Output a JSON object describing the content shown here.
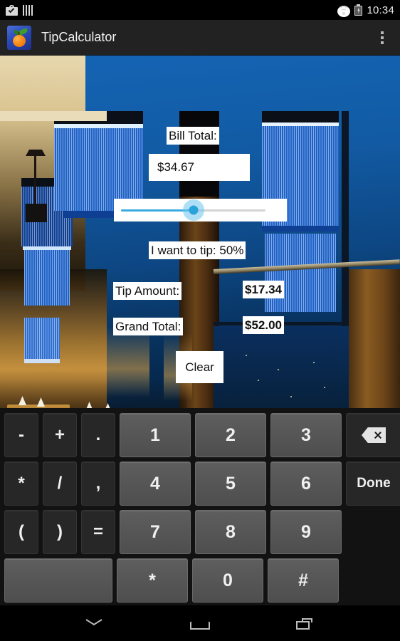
{
  "statusbar": {
    "time": "10:34",
    "icons": [
      "briefcase-check-icon",
      "barcode-icon",
      "wifi-icon",
      "battery-charging-icon"
    ]
  },
  "actionbar": {
    "app_title": "TipCalculator",
    "app_icon": "orange-fruit-icon",
    "overflow_label": "overflow-menu-icon"
  },
  "app": {
    "bill_label": "Bill Total:",
    "bill_value": "$34.67",
    "tip_percent_label": "I want to tip: 50%",
    "tip_percent": 50,
    "tip_amount_label": "Tip Amount:",
    "tip_amount_value": "$17.34",
    "grand_total_label": "Grand Total:",
    "grand_total_value": "$52.00",
    "clear_label": "Clear",
    "slider_accent": "#2aa3db",
    "widget_bg": "#ffffff",
    "widget_fg": "#101010"
  },
  "keyboard": {
    "rows": [
      [
        {
          "label": "-",
          "type": "fn",
          "name": "key-minus"
        },
        {
          "label": "+",
          "type": "fn",
          "name": "key-plus"
        },
        {
          "label": ".",
          "type": "fn",
          "name": "key-period"
        },
        {
          "label": "1",
          "type": "num",
          "name": "key-1"
        },
        {
          "label": "2",
          "type": "num",
          "name": "key-2"
        },
        {
          "label": "3",
          "type": "num",
          "name": "key-3"
        },
        {
          "label": "",
          "type": "bksp",
          "name": "key-backspace"
        }
      ],
      [
        {
          "label": "*",
          "type": "fn",
          "name": "key-asterisk-fn"
        },
        {
          "label": "/",
          "type": "fn",
          "name": "key-slash"
        },
        {
          "label": ",",
          "type": "fn",
          "name": "key-comma"
        },
        {
          "label": "4",
          "type": "num",
          "name": "key-4"
        },
        {
          "label": "5",
          "type": "num",
          "name": "key-5"
        },
        {
          "label": "6",
          "type": "num",
          "name": "key-6"
        },
        {
          "label": "Done",
          "type": "done",
          "name": "key-done"
        }
      ],
      [
        {
          "label": "(",
          "type": "fn",
          "name": "key-paren-open"
        },
        {
          "label": ")",
          "type": "fn",
          "name": "key-paren-close"
        },
        {
          "label": "=",
          "type": "fn",
          "name": "key-equals"
        },
        {
          "label": "7",
          "type": "num",
          "name": "key-7"
        },
        {
          "label": "8",
          "type": "num",
          "name": "key-8"
        },
        {
          "label": "9",
          "type": "num",
          "name": "key-9"
        },
        {
          "label": "",
          "type": "blank",
          "name": "key-blank-right-1"
        }
      ],
      [
        {
          "label": "",
          "type": "space",
          "name": "key-space"
        },
        {
          "label": "*",
          "type": "num",
          "name": "key-asterisk"
        },
        {
          "label": "0",
          "type": "num",
          "name": "key-0"
        },
        {
          "label": "#",
          "type": "num",
          "name": "key-hash"
        },
        {
          "label": "",
          "type": "blank",
          "name": "key-blank-right-2"
        }
      ]
    ]
  },
  "navbar": {
    "items": [
      {
        "name": "nav-hide-keyboard-icon"
      },
      {
        "name": "nav-home-icon"
      },
      {
        "name": "nav-recents-icon"
      }
    ]
  }
}
